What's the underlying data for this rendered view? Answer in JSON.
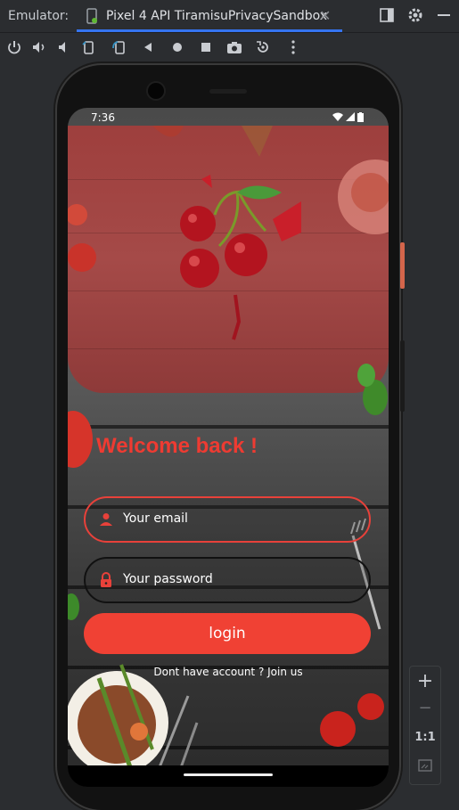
{
  "window": {
    "emulator_label": "Emulator:",
    "tab_label": "Pixel 4 API TiramisuPrivacySandbox",
    "tab_close": "✕"
  },
  "toolbar": {
    "icons": [
      "power-icon",
      "volume-up-icon",
      "volume-down-icon",
      "rotate-left-icon",
      "rotate-right-icon",
      "back-icon",
      "home-icon",
      "overview-icon",
      "camera-icon",
      "snapshot-icon",
      "more-icon"
    ]
  },
  "phone": {
    "status_time": "7:36",
    "welcome_title": "Welcome back !",
    "email_placeholder": "Your email",
    "password_placeholder": "Your password",
    "login_label": "login",
    "signup_text": "Dont have account ? Join us",
    "accent_color": "#f04134"
  },
  "zoom": {
    "plus": "+",
    "minus": "−",
    "actual_size": "1:1"
  }
}
